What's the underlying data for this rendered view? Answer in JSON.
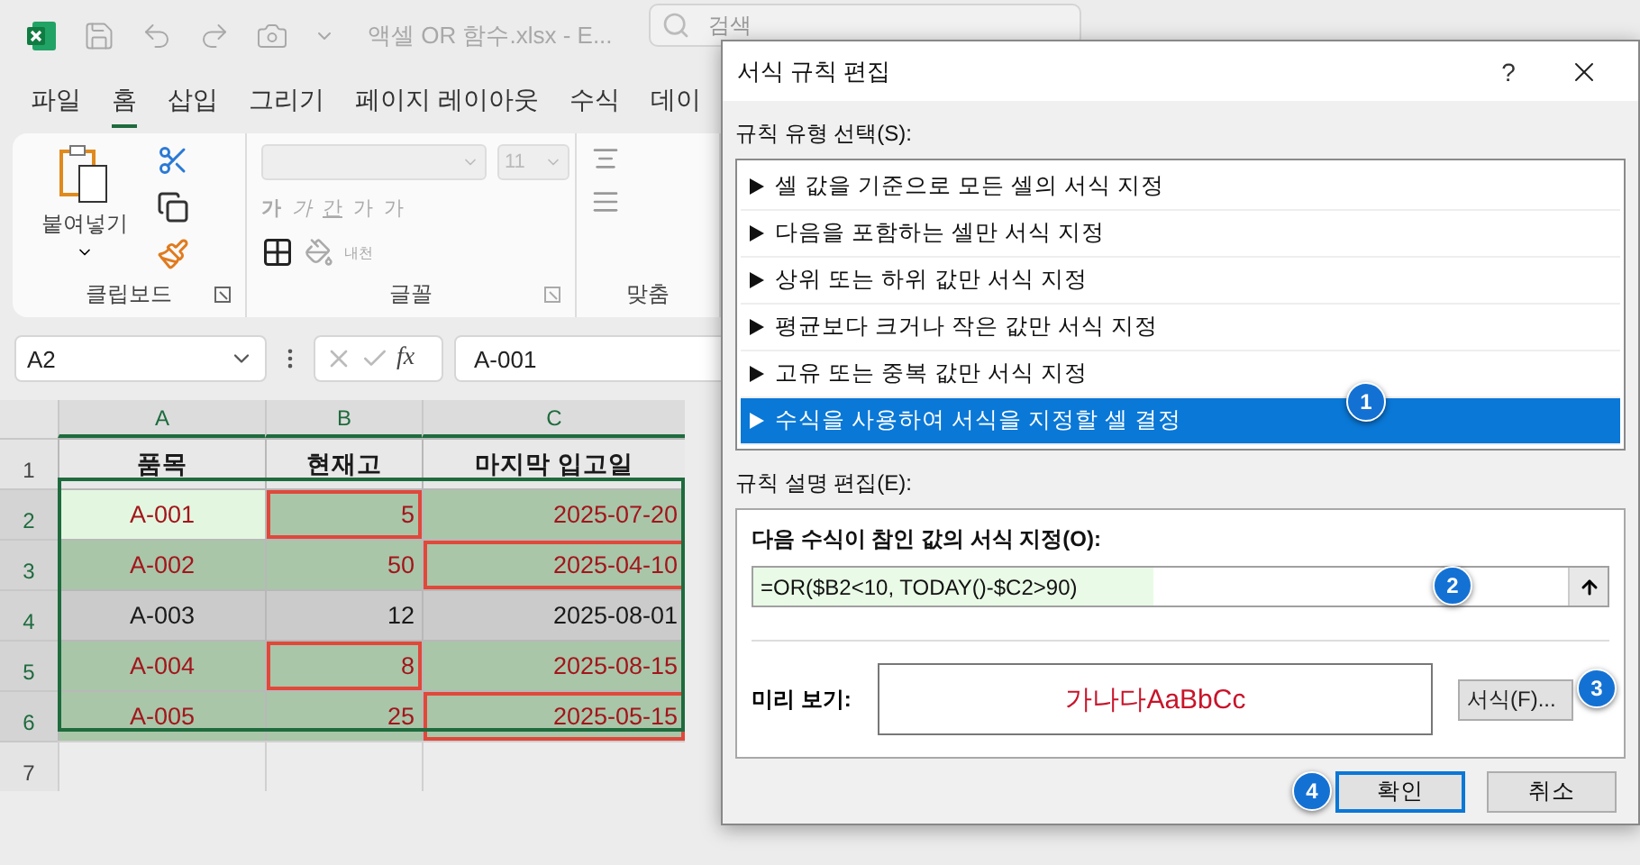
{
  "app": {
    "title": "액셀 OR 함수.xlsx  -  E...",
    "search_placeholder": "검색"
  },
  "menu_tabs": [
    {
      "label": "파일",
      "selected": false
    },
    {
      "label": "홈",
      "selected": true
    },
    {
      "label": "삽입",
      "selected": false
    },
    {
      "label": "그리기",
      "selected": false
    },
    {
      "label": "페이지 레이아웃",
      "selected": false
    },
    {
      "label": "수식",
      "selected": false
    },
    {
      "label": "데이",
      "selected": false
    }
  ],
  "ribbon": {
    "paste_label": "붙여넣기",
    "font_size": "11",
    "font_buttons": [
      "가",
      "가",
      "간",
      "가",
      "가"
    ],
    "phonetic": "내천",
    "groups": [
      "클립보드",
      "글꼴",
      "맞춤"
    ]
  },
  "formula_bar": {
    "name_box": "A2",
    "fx": "fx",
    "value": "A-001"
  },
  "grid": {
    "columns": [
      {
        "label": "A",
        "selected": true
      },
      {
        "label": "B",
        "selected": true
      },
      {
        "label": "C",
        "selected": true
      }
    ],
    "rows": [
      {
        "header": "1",
        "selected": false,
        "cells": [
          {
            "text": "품목",
            "kind": "heading",
            "highlighted": false,
            "outlined": false,
            "active": false
          },
          {
            "text": "현재고",
            "kind": "heading",
            "highlighted": false,
            "outlined": false,
            "active": false
          },
          {
            "text": "마지막 입고일",
            "kind": "heading",
            "highlighted": false,
            "outlined": false,
            "active": false
          }
        ]
      },
      {
        "header": "2",
        "selected": true,
        "cells": [
          {
            "text": "A-001",
            "kind": "center",
            "highlighted": true,
            "outlined": false,
            "active": true
          },
          {
            "text": "5",
            "kind": "right",
            "highlighted": true,
            "outlined": true,
            "active": false
          },
          {
            "text": "2025-07-20",
            "kind": "right",
            "highlighted": true,
            "outlined": false,
            "active": false
          }
        ]
      },
      {
        "header": "3",
        "selected": true,
        "cells": [
          {
            "text": "A-002",
            "kind": "center",
            "highlighted": true,
            "outlined": false,
            "active": false
          },
          {
            "text": "50",
            "kind": "right",
            "highlighted": true,
            "outlined": false,
            "active": false
          },
          {
            "text": "2025-04-10",
            "kind": "right",
            "highlighted": true,
            "outlined": true,
            "active": false
          }
        ]
      },
      {
        "header": "4",
        "selected": true,
        "cells": [
          {
            "text": "A-003",
            "kind": "center",
            "highlighted": false,
            "outlined": false,
            "active": false
          },
          {
            "text": "12",
            "kind": "right",
            "highlighted": false,
            "outlined": false,
            "active": false
          },
          {
            "text": "2025-08-01",
            "kind": "right",
            "highlighted": false,
            "outlined": false,
            "active": false
          }
        ]
      },
      {
        "header": "5",
        "selected": true,
        "cells": [
          {
            "text": "A-004",
            "kind": "center",
            "highlighted": true,
            "outlined": false,
            "active": false
          },
          {
            "text": "8",
            "kind": "right",
            "highlighted": true,
            "outlined": true,
            "active": false
          },
          {
            "text": "2025-08-15",
            "kind": "right",
            "highlighted": true,
            "outlined": false,
            "active": false
          }
        ]
      },
      {
        "header": "6",
        "selected": true,
        "cells": [
          {
            "text": "A-005",
            "kind": "center",
            "highlighted": true,
            "outlined": false,
            "active": false
          },
          {
            "text": "25",
            "kind": "right",
            "highlighted": true,
            "outlined": false,
            "active": false
          },
          {
            "text": "2025-05-15",
            "kind": "right",
            "highlighted": true,
            "outlined": true,
            "active": false
          }
        ]
      },
      {
        "header": "7",
        "selected": false,
        "cells": []
      }
    ]
  },
  "dialog": {
    "title": "서식 규칙 편집",
    "help": "?",
    "rule_type_label": "규칙 유형 선택(S):",
    "rule_types": [
      {
        "label": "셀 값을 기준으로 모든 셀의 서식 지정",
        "selected": false
      },
      {
        "label": "다음을 포함하는 셀만 서식 지정",
        "selected": false
      },
      {
        "label": "상위 또는 하위 값만 서식 지정",
        "selected": false
      },
      {
        "label": "평균보다 크거나 작은 값만 서식 지정",
        "selected": false
      },
      {
        "label": "고유 또는 중복 값만 서식 지정",
        "selected": false
      },
      {
        "label": "수식을 사용하여 서식을 지정할 셀 결정",
        "selected": true,
        "badge": "1"
      }
    ],
    "edit_label": "규칙 설명 편집(E):",
    "formula_heading": "다음 수식이 참인 값의 서식 지정(O):",
    "formula": "=OR($B2<10, TODAY()-$C2>90)",
    "formula_badge": "2",
    "preview_label": "미리 보기:",
    "preview_text": "가나다AaBbCc",
    "format_button": "서식(F)...",
    "format_badge": "3",
    "buttons": [
      {
        "label": "확인",
        "default": true,
        "badge": "4"
      },
      {
        "label": "취소",
        "default": false
      }
    ]
  }
}
